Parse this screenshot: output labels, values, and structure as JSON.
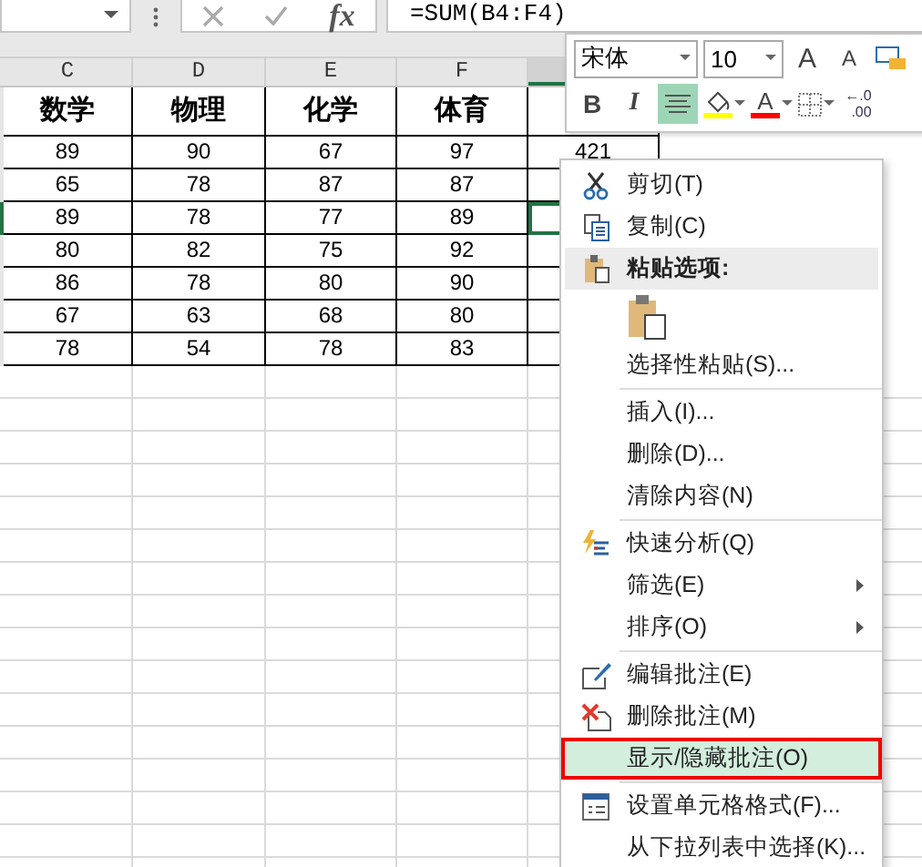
{
  "formula_bar": {
    "fx": "fx",
    "formula": "=SUM(B4:F4)"
  },
  "columns": [
    {
      "label": "C",
      "selected": false
    },
    {
      "label": "D",
      "selected": false
    },
    {
      "label": "E",
      "selected": false
    },
    {
      "label": "F",
      "selected": false
    },
    {
      "selected": true
    }
  ],
  "rows": [
    {
      "kind": "heading",
      "selected": false,
      "cells": [
        "数学",
        "物理",
        "化学",
        "体育"
      ]
    },
    {
      "kind": "data",
      "selected": false,
      "cells": [
        "89",
        "90",
        "67",
        "97",
        "421"
      ]
    },
    {
      "kind": "data",
      "selected": false,
      "cells": [
        "65",
        "78",
        "87",
        "87"
      ]
    },
    {
      "kind": "data",
      "selected": true,
      "cells": [
        "89",
        "78",
        "77",
        "89"
      ]
    },
    {
      "kind": "data",
      "selected": false,
      "cells": [
        "80",
        "82",
        "75",
        "92"
      ]
    },
    {
      "kind": "data",
      "selected": false,
      "cells": [
        "86",
        "78",
        "80",
        "90"
      ]
    },
    {
      "kind": "data",
      "selected": false,
      "cells": [
        "67",
        "63",
        "68",
        "80"
      ]
    },
    {
      "kind": "data",
      "selected": false,
      "cells": [
        "78",
        "54",
        "78",
        "83"
      ]
    }
  ],
  "mini_toolbar": {
    "font": "宋体",
    "size": "10",
    "top_buttons": [
      {
        "kind": "grow",
        "label": "A"
      },
      {
        "kind": "shrink",
        "label": "A"
      },
      {
        "kind": "format"
      }
    ],
    "buttons": [
      {
        "kind": "bold",
        "label": "B",
        "selected": false
      },
      {
        "kind": "italic",
        "label": "I",
        "selected": false
      },
      {
        "kind": "align",
        "selected": true
      },
      {
        "kind": "fill",
        "color": "#ffff00",
        "selected": false
      },
      {
        "kind": "fontcolor",
        "label": "A",
        "color": "#ff0000",
        "selected": false
      },
      {
        "kind": "borders",
        "selected": false
      },
      {
        "kind": "decimal",
        "lines": [
          "←.0",
          ".00"
        ],
        "selected": false
      }
    ]
  },
  "menu": {
    "sections": [
      [
        {
          "kind": "command",
          "label": "剪切(T)",
          "selected": false,
          "submenu": false
        },
        {
          "kind": "command",
          "label": "复制(C)",
          "selected": false,
          "submenu": false
        },
        {
          "kind": "header",
          "label": "粘贴选项:",
          "selected": false,
          "submenu": false
        },
        {
          "kind": "paste_icons",
          "selected": false
        },
        {
          "kind": "command",
          "label": "选择性粘贴(S)...",
          "selected": false,
          "submenu": false
        }
      ],
      [
        {
          "kind": "command",
          "label": "插入(I)...",
          "selected": false,
          "submenu": false
        },
        {
          "kind": "command",
          "label": "删除(D)...",
          "selected": false,
          "submenu": false
        },
        {
          "kind": "command",
          "label": "清除内容(N)",
          "selected": false,
          "submenu": false
        }
      ],
      [
        {
          "kind": "command",
          "label": "快速分析(Q)",
          "selected": false,
          "submenu": false
        },
        {
          "kind": "command",
          "label": "筛选(E)",
          "selected": false,
          "submenu": true
        },
        {
          "kind": "command",
          "label": "排序(O)",
          "selected": false,
          "submenu": true
        }
      ],
      [
        {
          "kind": "command",
          "label": "编辑批注(E)",
          "selected": false,
          "submenu": false
        },
        {
          "kind": "command",
          "label": "删除批注(M)",
          "selected": false,
          "submenu": false
        },
        {
          "kind": "command",
          "label": "显示/隐藏批注(O)",
          "selected": true,
          "submenu": false
        }
      ],
      [
        {
          "kind": "command",
          "label": "设置单元格格式(F)...",
          "selected": false,
          "submenu": false
        },
        {
          "kind": "command",
          "label": "从下拉列表中选择(K)...",
          "selected": false,
          "submenu": false
        }
      ]
    ]
  }
}
